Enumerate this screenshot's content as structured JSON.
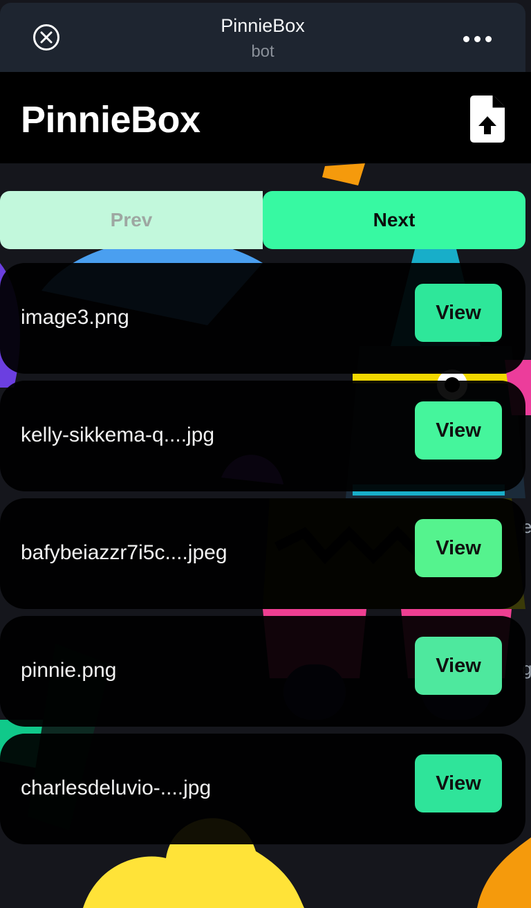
{
  "topbar": {
    "title": "PinnieBox",
    "subtitle": "bot",
    "close_icon": "close-circle-icon",
    "more_icon": "more-dots-icon"
  },
  "header": {
    "title": "PinnieBox",
    "upload_icon": "file-upload-icon"
  },
  "pager": {
    "prev_label": "Prev",
    "next_label": "Next"
  },
  "files": [
    {
      "name": "image3.png",
      "view_label": "View"
    },
    {
      "name": "kelly-sikkema-q....jpg",
      "view_label": "View"
    },
    {
      "name": "bafybeiazzr7i5c....jpeg",
      "view_label": "View"
    },
    {
      "name": "pinnie.png",
      "view_label": "View"
    },
    {
      "name": "charlesdeluvio-....jpg",
      "view_label": "View"
    }
  ],
  "colors": {
    "accent": "#37f9a2",
    "accent_disabled": "#c2f8dc",
    "background": "#15161c",
    "topbar": "#1e2530"
  }
}
